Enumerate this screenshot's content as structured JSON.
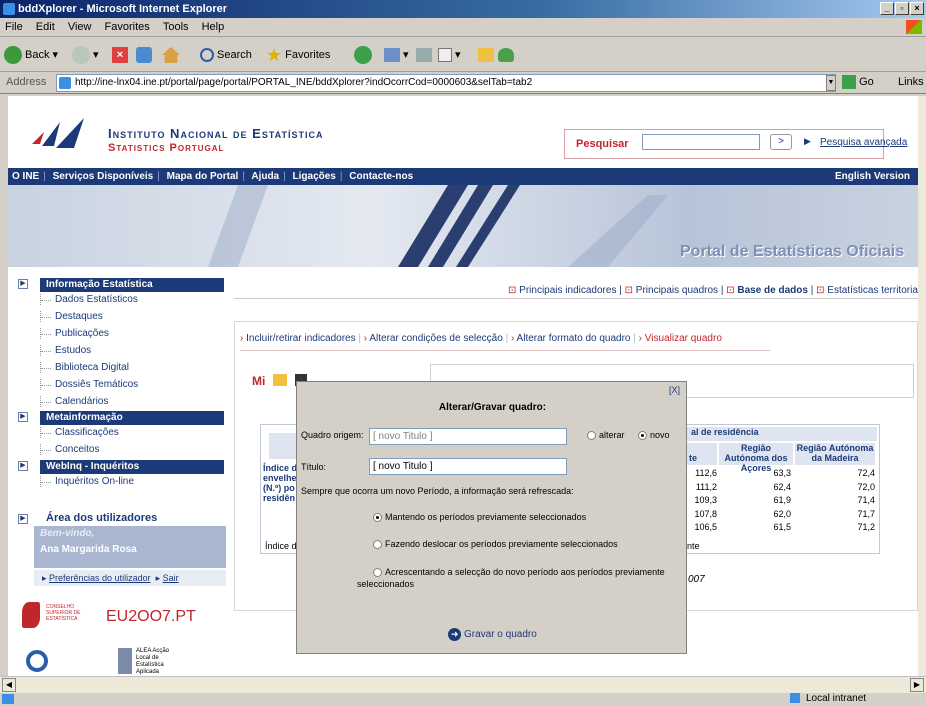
{
  "window": {
    "title": "bddXplorer - Microsoft Internet Explorer",
    "min": "_",
    "max": "▫",
    "close": "×"
  },
  "menu": [
    "File",
    "Edit",
    "View",
    "Favorites",
    "Tools",
    "Help"
  ],
  "toolbar": {
    "back": "Back",
    "search": "Search",
    "favorites": "Favorites"
  },
  "address": {
    "label": "Address",
    "url": "http://ine-lnx04.ine.pt/portal/page/portal/PORTAL_INE/bddXplorer?indOcorrCod=0000603&selTab=tab2",
    "go": "Go",
    "links": "Links"
  },
  "header": {
    "institute": "Instituto Nacional de Estatística",
    "subtitle": "Statistics Portugal",
    "search_label": "Pesquisar",
    "search_value": "",
    "search_btn": ">",
    "advanced": "Pesquisa avançada"
  },
  "nav": {
    "items": [
      "O INE",
      "Serviços Disponíveis",
      "Mapa do Portal",
      "Ajuda",
      "Ligações",
      "Contacte-nos"
    ],
    "english": "English Version"
  },
  "banner": {
    "text": "Portal de Estatísticas Oficiais"
  },
  "sidebar": {
    "sections": [
      {
        "title": "Informação Estatística",
        "items": [
          "Dados Estatísticos",
          "Destaques",
          "Publicações",
          "Estudos",
          "Biblioteca Digital",
          "Dossiês Temáticos",
          "Calendários"
        ]
      },
      {
        "title": "Metainformação",
        "items": [
          "Classificações",
          "Conceitos"
        ]
      },
      {
        "title": "WebInq - Inquéritos",
        "items": [
          "Inquéritos On-line"
        ]
      }
    ],
    "users_area": "Área dos utilizadores",
    "welcome": "Bem-vindo,",
    "user": "Ana Margarida Rosa",
    "prefs": "Preferências do utilizador",
    "logout": "Sair",
    "logo1_small": "CONSELHO SUPERIOR DE ESTATÍSTICA",
    "logo1_big": "EU2OO7.PT",
    "logo2": "ALEA Acção Local de Estatística Aplicada"
  },
  "tabs": {
    "items": [
      "Principais indicadores",
      "Principais quadros",
      "Base de dados",
      "Estatísticas territoria"
    ],
    "active_index": 2
  },
  "subtabs": [
    "Incluir/retirar indicadores",
    "Alterar condições de selecção",
    "Alterar formato do quadro",
    "Visualizar quadro"
  ],
  "table": {
    "group_header": "al de residência",
    "columns": [
      "te",
      "Região Autónoma dos Açores",
      "Região Autónoma da Madeira"
    ],
    "row_label": [
      "Índice d",
      "envelhe",
      "(N.º) po",
      "residên"
    ],
    "rows": [
      [
        "112,6",
        "63,3",
        "72,4"
      ],
      [
        "111,2",
        "62,4",
        "72,0"
      ],
      [
        "109,3",
        "61,9",
        "71,4"
      ],
      [
        "107,8",
        "62,0",
        "71,7"
      ],
      [
        "106,5",
        "61,5",
        "71,2"
      ]
    ],
    "footer_left": "Índice de",
    "footer_right": "nte",
    "year_frag": "007"
  },
  "modal": {
    "close": "[X]",
    "title": "Alterar/Gravar quadro:",
    "origin_label": "Quadro origem:",
    "origin_value": "[ novo Titulo ]",
    "opt_alterar": "alterar",
    "opt_novo": "novo",
    "title_label": "Título:",
    "title_value": "[ novo Titulo ]",
    "refresh_note": "Sempre que ocorra um novo Período, a informação será refrescada:",
    "options": [
      "Mantendo os períodos previamente seleccionados",
      "Fazendo deslocar os períodos previamente seleccionados",
      "Acrescentando a selecção do novo período aos períodos previamente seleccionados"
    ],
    "save": "Gravar o quadro"
  },
  "status": {
    "zone": "Local intranet"
  }
}
